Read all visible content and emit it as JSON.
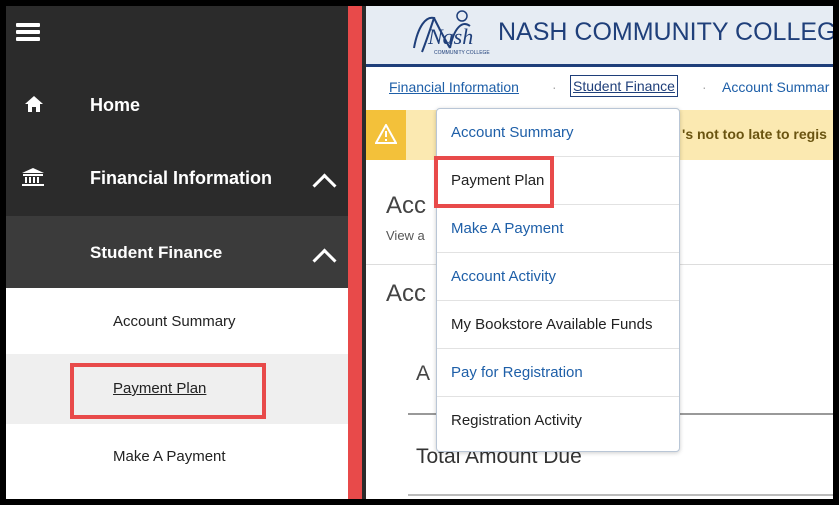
{
  "sidebar": {
    "home_label": "Home",
    "financial_label": "Financial Information",
    "student_finance_label": "Student Finance",
    "items": [
      {
        "label": "Account Summary"
      },
      {
        "label": "Payment Plan"
      },
      {
        "label": "Make A Payment"
      }
    ]
  },
  "header": {
    "college_name": "NASH COMMUNITY COLLEGE",
    "logo_script": "Nash",
    "logo_small": "COMMUNITY COLLEGE"
  },
  "breadcrumb": {
    "items": [
      "Financial Information",
      "Student Finance",
      "Account Summar"
    ],
    "separator": "·"
  },
  "alert": {
    "text": "'s not too late to regis"
  },
  "content": {
    "title1": "Acc",
    "subtitle": "View a",
    "title2": "Acc",
    "section_a": "A",
    "total_label": "Total Amount Due"
  },
  "dropdown": {
    "items": [
      {
        "label": "Account Summary"
      },
      {
        "label": "Payment Plan"
      },
      {
        "label": "Make A Payment"
      },
      {
        "label": "Account Activity"
      },
      {
        "label": "My Bookstore Available Funds"
      },
      {
        "label": "Pay for Registration"
      },
      {
        "label": "Registration Activity"
      }
    ]
  },
  "colors": {
    "highlight_red": "#e84a4a",
    "college_blue": "#1f3f7a",
    "link_blue": "#1e5fa8",
    "alert_yellow": "#f3c13a"
  }
}
